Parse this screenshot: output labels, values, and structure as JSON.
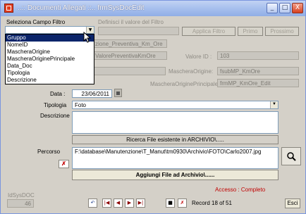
{
  "window": {
    "title": "..:: Documenti Allegati ::..    frmSysDocEdit",
    "buttons": {
      "minimize": "_",
      "maximize": "□",
      "close": "X"
    }
  },
  "filter": {
    "campo_label": "Seleziona Campo Filtro",
    "campo_value": "",
    "valore_label": "Definisci il valore del Filtro",
    "applica_label": "Applica Filtro",
    "primo_label": "Primo",
    "prossimo_label": "Prossimo",
    "options": [
      "Gruppo",
      "NomeID",
      "MascheraOrigine",
      "MascheraOriginePrincipale",
      "Data_Doc",
      "Tipologia",
      "Descrizione"
    ],
    "selected_index": 0
  },
  "background_fields": {
    "gruppo_value": "zione_Preventiva_Km_Ore",
    "nomeid_value": "ValorePreventivaKmOre",
    "valore_id_label": "Valore ID :",
    "valore_id_value": "103",
    "maschera_origine_label": "MascheraOrigine:",
    "maschera_origine_value": "fsubMP_KmOre",
    "maschera_principale_label": "MascheraOriginePrincipale :",
    "maschera_principale_value": "frmMP_KmOre_Edit"
  },
  "form": {
    "data_label": "Data :",
    "data_value": "23/06/2011",
    "tipologia_label": "Tipologia",
    "tipologia_value": "Foto",
    "descrizione_label": "Descrizione",
    "descrizione_value": "",
    "ricerca_label": "Ricerca File esistente in ARCHIVIO\\.....",
    "percorso_label": "Percorso",
    "percorso_value": "F:\\database\\Manutenzione\\T_Manut\\tm0930\\Archivio\\FOTO\\Carlo2007.jpg",
    "aggiungi_label": "Aggiungi File ad Archivio\\......"
  },
  "footer": {
    "access_label": "Accesso : Completo",
    "record_label": "Record 18 of 51",
    "esci_label": "Esci",
    "left_caption": "IdSysDOC",
    "left_value": "46"
  },
  "colors": {
    "accent": "#0a246a",
    "access_text": "#c00000",
    "nav_arrows": "#8b0000"
  }
}
